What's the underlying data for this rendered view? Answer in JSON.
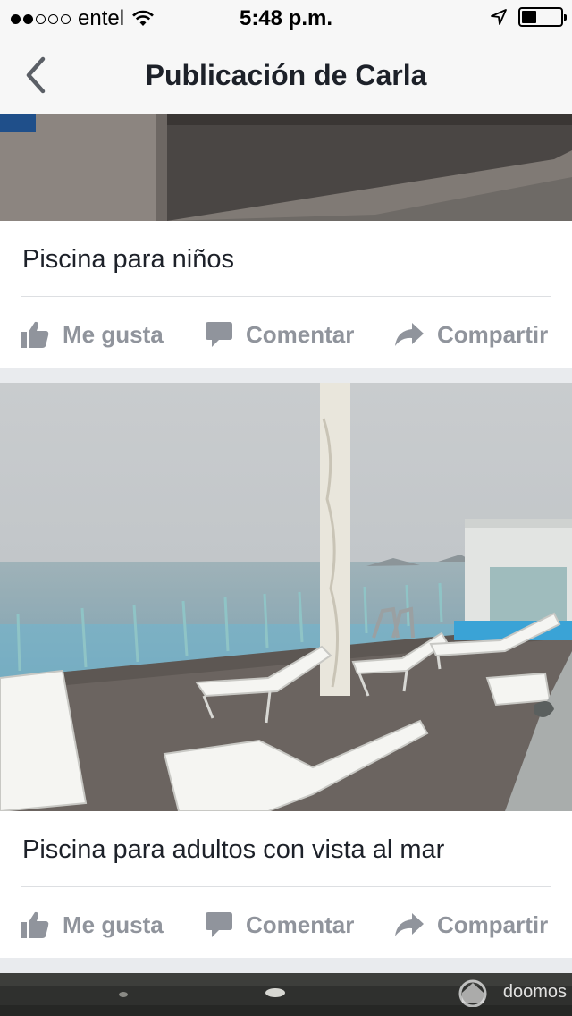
{
  "status_bar": {
    "carrier": "entel",
    "time": "5:48 p.m.",
    "signal_bars_filled": 2,
    "signal_bars_total": 5,
    "battery_level": 0.35
  },
  "nav": {
    "title": "Publicación de Carla",
    "back_icon": "chevron-left-icon"
  },
  "posts": [
    {
      "caption": "Piscina para niños",
      "actions": {
        "like": "Me gusta",
        "comment": "Comentar",
        "share": "Compartir"
      }
    },
    {
      "caption": "Piscina para adultos con vista al mar",
      "actions": {
        "like": "Me gusta",
        "comment": "Comentar",
        "share": "Compartir"
      }
    }
  ],
  "watermark": "doomos",
  "colors": {
    "action_gray": "#90949c",
    "text": "#1d2129",
    "divider": "#dddfe2",
    "feed_bg": "#e9ebee"
  }
}
